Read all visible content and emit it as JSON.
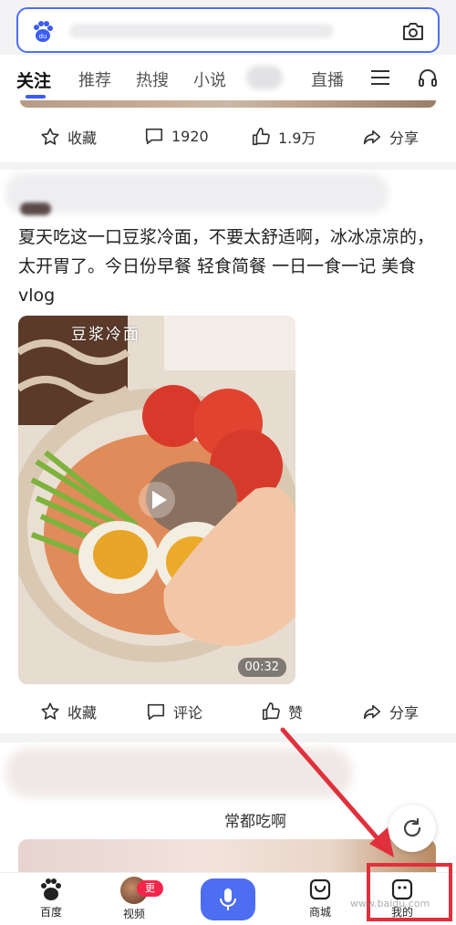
{
  "search": {
    "logo_text": "du",
    "icons": {
      "logo": "baidu-paw-logo",
      "camera": "camera-icon"
    }
  },
  "tabs": [
    {
      "label": "关注",
      "active": true
    },
    {
      "label": "推荐"
    },
    {
      "label": "热搜"
    },
    {
      "label": "小说"
    },
    {
      "label": "直播"
    }
  ],
  "top_card": {
    "actions": {
      "favorite": "收藏",
      "comments": "1920",
      "likes": "1.9万",
      "share": "分享"
    }
  },
  "main_card": {
    "text": "夏天吃这一口豆浆冷面，不要太舒适啊，冰冰凉凉的，太开胃了。今日份早餐 轻食简餐 一日一食一记 美食vlog",
    "video": {
      "caption": "豆浆冷面",
      "duration": "00:32"
    },
    "actions": {
      "favorite": "收藏",
      "comment": "评论",
      "like": "赞",
      "share": "分享"
    }
  },
  "lower_card": {
    "visible_text": "常都吃啊"
  },
  "bottom_nav": {
    "baidu": "百度",
    "video": "视频",
    "video_badge": "更新",
    "mall": "商城",
    "mine": "我的"
  },
  "watermark": "www.baidu.com",
  "colors": {
    "accent": "#4e6ef2",
    "annotation": "#e0303c",
    "badge": "#f5264b"
  }
}
